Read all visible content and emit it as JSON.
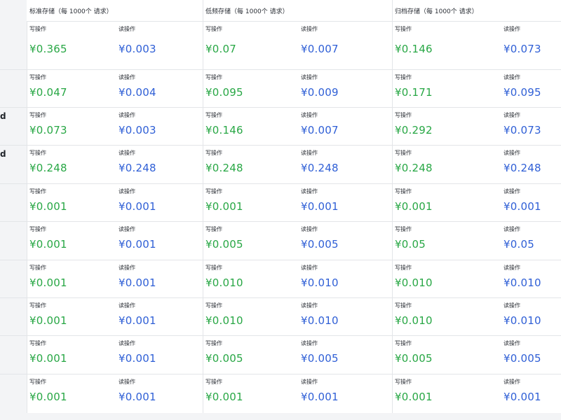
{
  "colors": {
    "write": "#28a745",
    "read": "#2f5fd6",
    "border": "#e3e5e8",
    "sidebar_bg": "#f3f4f6"
  },
  "columns": [
    {
      "title": "标准存储（每 1000个 请求）"
    },
    {
      "title": "低频存储（每 1000个 请求）"
    },
    {
      "title": "归档存储（每 1000个 请求）"
    }
  ],
  "side_markers": [
    "d",
    "d"
  ],
  "rows": [
    {
      "cells": [
        {
          "write_label": "写操作",
          "write": "¥0.365",
          "read_label": "读操作",
          "read": "¥0.003"
        },
        {
          "write_label": "写操作",
          "write": "¥0.07",
          "read_label": "读操作",
          "read": "¥0.007"
        },
        {
          "write_label": "写操作",
          "write": "¥0.146",
          "read_label": "读操作",
          "read": "¥0.073"
        }
      ]
    },
    {
      "cells": [
        {
          "write_label": "写操作",
          "write": "¥0.047",
          "read_label": "读操作",
          "read": "¥0.004"
        },
        {
          "write_label": "写操作",
          "write": "¥0.095",
          "read_label": "读操作",
          "read": "¥0.009"
        },
        {
          "write_label": "写操作",
          "write": "¥0.171",
          "read_label": "读操作",
          "read": "¥0.095"
        }
      ]
    },
    {
      "cells": [
        {
          "write_label": "写操作",
          "write": "¥0.073",
          "read_label": "读操作",
          "read": "¥0.003"
        },
        {
          "write_label": "写操作",
          "write": "¥0.146",
          "read_label": "读操作",
          "read": "¥0.007"
        },
        {
          "write_label": "写操作",
          "write": "¥0.292",
          "read_label": "读操作",
          "read": "¥0.073"
        }
      ]
    },
    {
      "cells": [
        {
          "write_label": "写操作",
          "write": "¥0.248",
          "read_label": "读操作",
          "read": "¥0.248"
        },
        {
          "write_label": "写操作",
          "write": "¥0.248",
          "read_label": "读操作",
          "read": "¥0.248"
        },
        {
          "write_label": "写操作",
          "write": "¥0.248",
          "read_label": "读操作",
          "read": "¥0.248"
        }
      ]
    },
    {
      "cells": [
        {
          "write_label": "写操作",
          "write": "¥0.001",
          "read_label": "读操作",
          "read": "¥0.001"
        },
        {
          "write_label": "写操作",
          "write": "¥0.001",
          "read_label": "读操作",
          "read": "¥0.001"
        },
        {
          "write_label": "写操作",
          "write": "¥0.001",
          "read_label": "读操作",
          "read": "¥0.001"
        }
      ]
    },
    {
      "cells": [
        {
          "write_label": "写操作",
          "write": "¥0.001",
          "read_label": "读操作",
          "read": "¥0.001"
        },
        {
          "write_label": "写操作",
          "write": "¥0.005",
          "read_label": "读操作",
          "read": "¥0.005"
        },
        {
          "write_label": "写操作",
          "write": "¥0.05",
          "read_label": "读操作",
          "read": "¥0.05"
        }
      ]
    },
    {
      "cells": [
        {
          "write_label": "写操作",
          "write": "¥0.001",
          "read_label": "读操作",
          "read": "¥0.001"
        },
        {
          "write_label": "写操作",
          "write": "¥0.010",
          "read_label": "读操作",
          "read": "¥0.010"
        },
        {
          "write_label": "写操作",
          "write": "¥0.010",
          "read_label": "读操作",
          "read": "¥0.010"
        }
      ]
    },
    {
      "cells": [
        {
          "write_label": "写操作",
          "write": "¥0.001",
          "read_label": "读操作",
          "read": "¥0.001"
        },
        {
          "write_label": "写操作",
          "write": "¥0.010",
          "read_label": "读操作",
          "read": "¥0.010"
        },
        {
          "write_label": "写操作",
          "write": "¥0.010",
          "read_label": "读操作",
          "read": "¥0.010"
        }
      ]
    },
    {
      "cells": [
        {
          "write_label": "写操作",
          "write": "¥0.001",
          "read_label": "读操作",
          "read": "¥0.001"
        },
        {
          "write_label": "写操作",
          "write": "¥0.005",
          "read_label": "读操作",
          "read": "¥0.005"
        },
        {
          "write_label": "写操作",
          "write": "¥0.005",
          "read_label": "读操作",
          "read": "¥0.005"
        }
      ]
    },
    {
      "cells": [
        {
          "write_label": "写操作",
          "write": "¥0.001",
          "read_label": "读操作",
          "read": "¥0.001"
        },
        {
          "write_label": "写操作",
          "write": "¥0.001",
          "read_label": "读操作",
          "read": "¥0.001"
        },
        {
          "write_label": "写操作",
          "write": "¥0.001",
          "read_label": "读操作",
          "read": "¥0.001"
        }
      ]
    }
  ]
}
